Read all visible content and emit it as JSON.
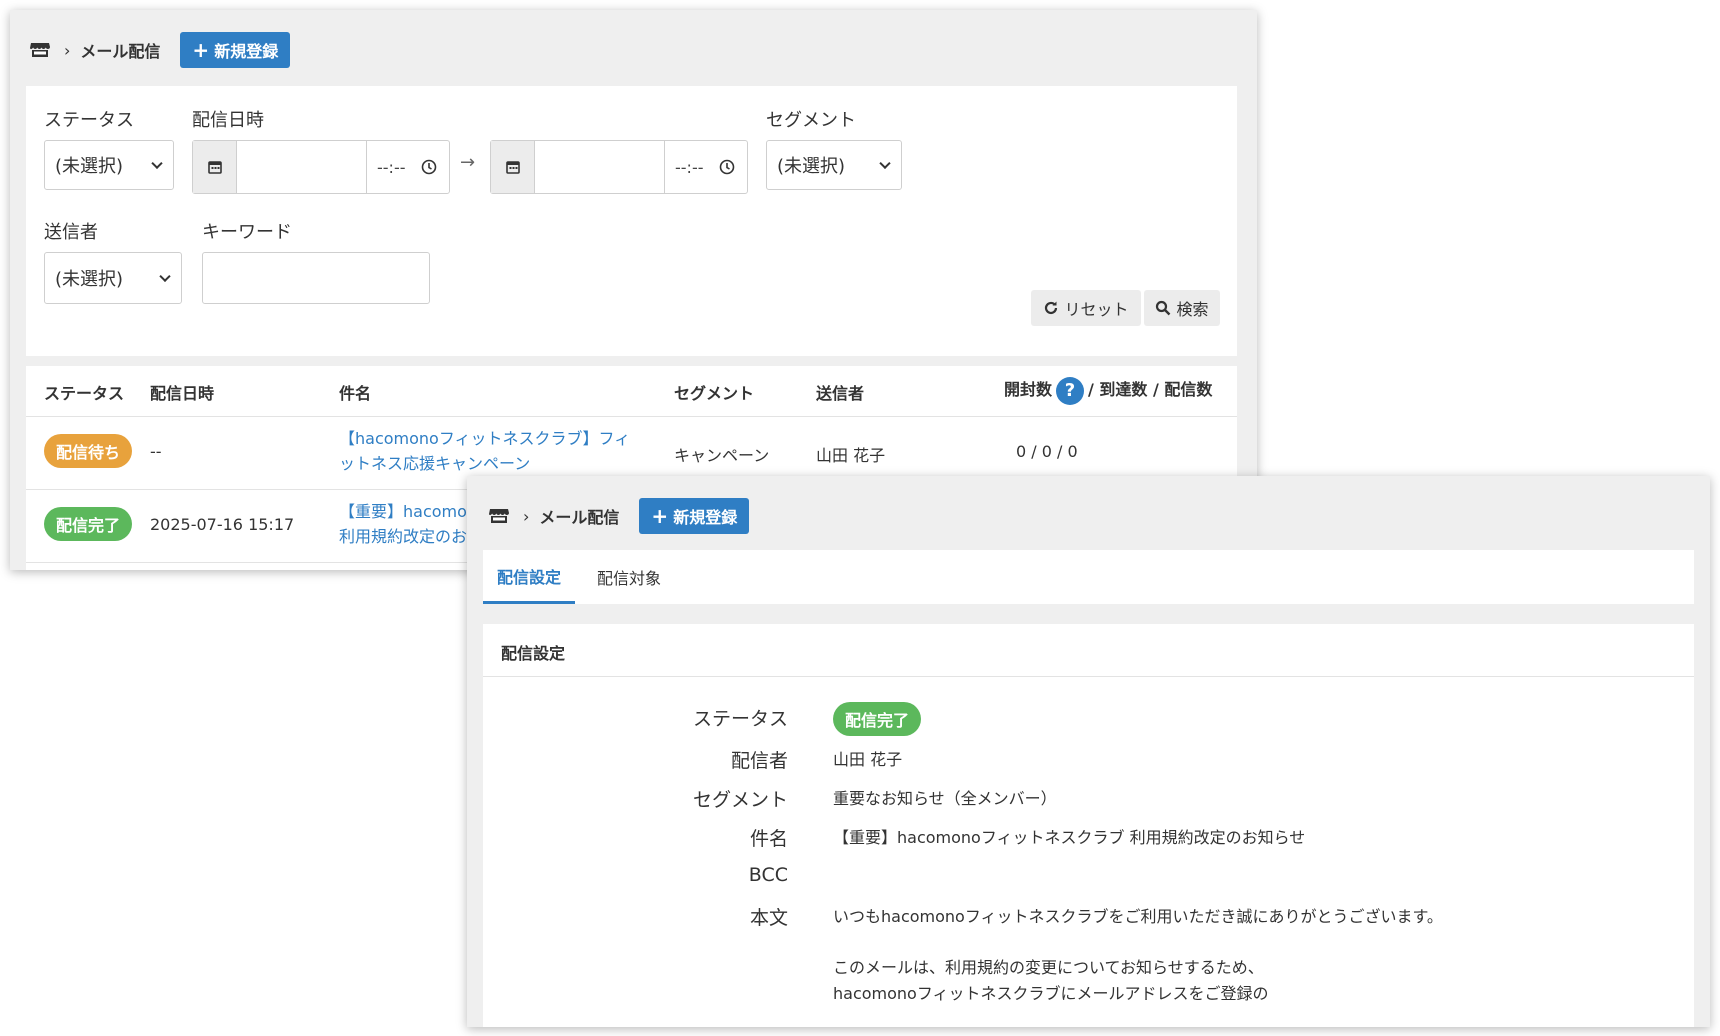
{
  "breadcrumb": {
    "home_icon": "shop-icon",
    "chevron": "›",
    "current": "メール配信"
  },
  "new_button": {
    "plus": "+",
    "label": "新規登録"
  },
  "filters": {
    "status": {
      "label": "ステータス",
      "value": "(未選択)"
    },
    "datetime": {
      "label": "配信日時",
      "from_time_placeholder": "--:--",
      "to_time_placeholder": "--:--",
      "arrow": "→"
    },
    "segment": {
      "label": "セグメント",
      "value": "(未選択)"
    },
    "sender": {
      "label": "送信者",
      "value": "(未選択)"
    },
    "keyword": {
      "label": "キーワード",
      "value": ""
    },
    "reset_label": "リセット",
    "search_label": "検索"
  },
  "table": {
    "headers": {
      "status": "ステータス",
      "datetime": "配信日時",
      "subject": "件名",
      "segment": "セグメント",
      "sender": "送信者",
      "opened": "開封数",
      "help": "?",
      "rest": "/ 到達数 / 配信数"
    },
    "rows": [
      {
        "status": "配信待ち",
        "status_color": "#e8a23c",
        "datetime": "--",
        "subject_line1": "【hacomonoフィットネスクラブ】フィ",
        "subject_line2": "ットネス応援キャンペーン",
        "segment": "キャンペーン",
        "sender": "山田 花子",
        "counts": "0 / 0 / 0"
      },
      {
        "status": "配信完了",
        "status_color": "#5cb85c",
        "datetime": "2025-07-16 15:17",
        "subject_line1": "【重要】hacomo",
        "subject_line2": "利用規約改定のお"
      }
    ]
  },
  "detail": {
    "tabs": [
      {
        "label": "配信設定",
        "active": true
      },
      {
        "label": "配信対象",
        "active": false
      }
    ],
    "section_title": "配信設定",
    "fields": {
      "status": {
        "label": "ステータス",
        "value": "配信完了"
      },
      "distributor": {
        "label": "配信者",
        "value": "山田 花子"
      },
      "segment": {
        "label": "セグメント",
        "value": "重要なお知らせ（全メンバー）"
      },
      "subject": {
        "label": "件名",
        "value": "【重要】hacomonoフィットネスクラブ 利用規約改定のお知らせ"
      },
      "bcc": {
        "label": "BCC",
        "value": ""
      },
      "body": {
        "label": "本文",
        "line1": "いつもhacomonoフィットネスクラブをご利用いただき誠にありがとうございます。",
        "line2": "このメールは、利用規約の変更についてお知らせするため、",
        "line3": "hacomonoフィットネスクラブにメールアドレスをご登録の"
      }
    }
  },
  "colors": {
    "primary": "#2f7ec4",
    "waiting": "#e8a23c",
    "done": "#5cb85c"
  }
}
